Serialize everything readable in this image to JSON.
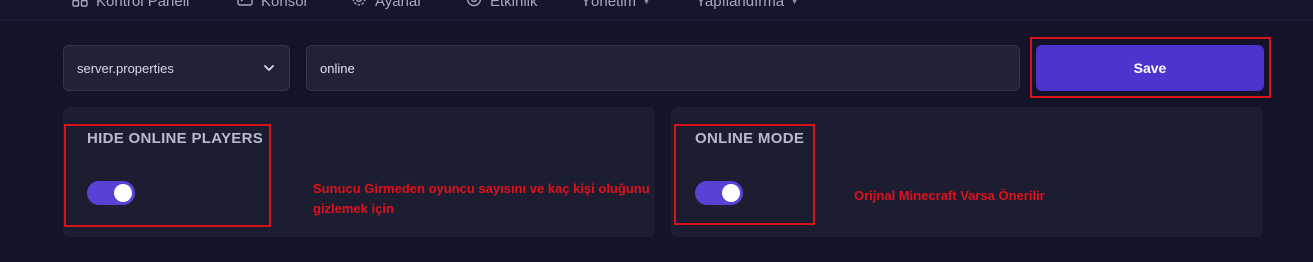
{
  "nav": {
    "items": [
      {
        "label": "Kontrol Paneli",
        "icon": "grid-icon",
        "has_chevron": false
      },
      {
        "label": "Konsol",
        "icon": "terminal-icon",
        "has_chevron": false
      },
      {
        "label": "Ayarlar",
        "icon": "gear-icon",
        "has_chevron": false
      },
      {
        "label": "Etkinlik",
        "icon": "eye-icon",
        "has_chevron": false
      },
      {
        "label": "Yönetim",
        "icon": "",
        "has_chevron": true
      },
      {
        "label": "Yapılandırma",
        "icon": "",
        "has_chevron": true
      }
    ],
    "chevron_glyph": "▼"
  },
  "toolbar": {
    "file_select_value": "server.properties",
    "search_value": "online",
    "save_label": "Save"
  },
  "properties": [
    {
      "title": "HIDE ONLINE PLAYERS",
      "enabled": true
    },
    {
      "title": "ONLINE MODE",
      "enabled": true
    }
  ],
  "annotations": {
    "hide_players_note_line1": "Sunucu Girmeden oyuncu sayısını ve kaç kişi oluğunu",
    "hide_players_note_line2": "gizlemek için",
    "online_mode_note": "Orijnal Minecraft Varsa Önerilir"
  },
  "colors": {
    "background": "#13132a",
    "card": "#1d1d32",
    "accent": "#4c35cf",
    "toggle_on": "#5a41d6",
    "annotation_red": "#d7141c"
  }
}
